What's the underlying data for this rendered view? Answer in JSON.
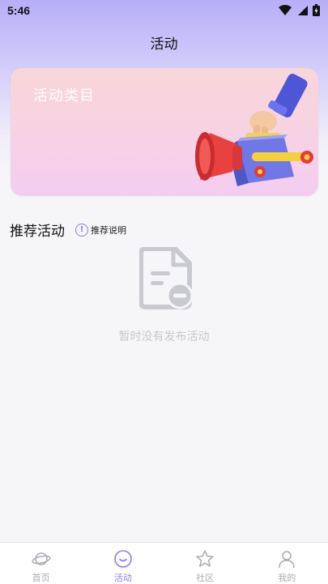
{
  "status_bar": {
    "time": "5:46",
    "icons": [
      "wifi-icon",
      "signal-icon",
      "battery-icon"
    ]
  },
  "header": {
    "title": "活动"
  },
  "banner": {
    "label": "活动类目",
    "art": "megaphone-box-illustration"
  },
  "section": {
    "title": "推荐活动",
    "hint_label": "推荐说明",
    "hint_icon": "info-icon"
  },
  "empty_state": {
    "icon": "document-minus-icon",
    "message": "暂时没有发布活动"
  },
  "tabbar": {
    "active_color": "#8c7cf0",
    "inactive_color": "#a9abb3",
    "items": [
      {
        "label": "首页",
        "icon": "planet-icon",
        "active": false
      },
      {
        "label": "活动",
        "icon": "smile-icon",
        "active": true
      },
      {
        "label": "社区",
        "icon": "star-icon",
        "active": false
      },
      {
        "label": "我的",
        "icon": "person-icon",
        "active": false
      }
    ]
  }
}
